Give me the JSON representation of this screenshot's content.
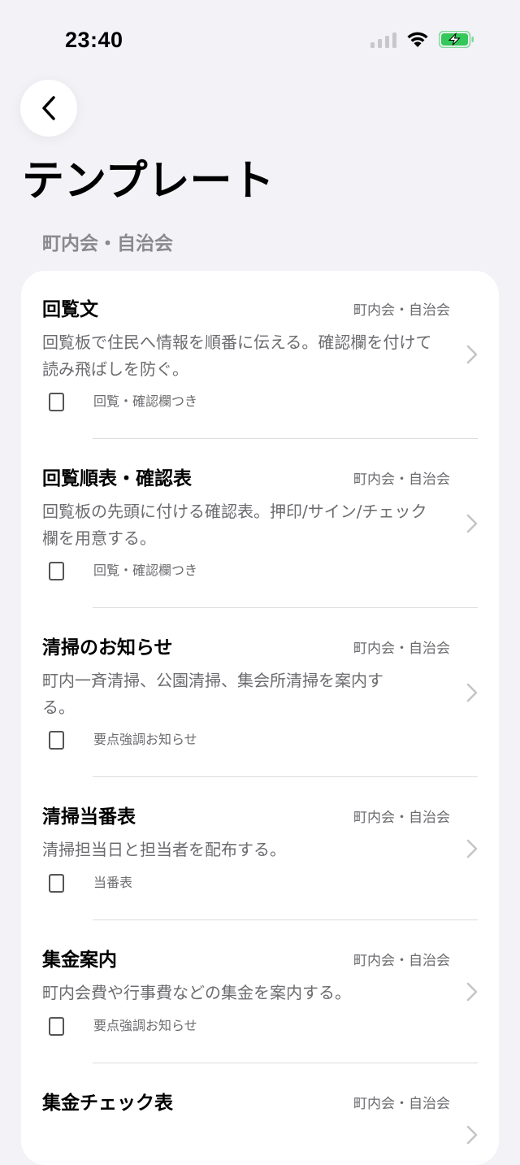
{
  "status_bar": {
    "time": "23:40"
  },
  "page": {
    "title": "テンプレート",
    "section": "町内会・自治会"
  },
  "items": [
    {
      "title": "回覧文",
      "category": "町内会・自治会",
      "description": "回覧板で住民へ情報を順番に伝える。確認欄を付けて読み飛ばしを防ぐ。",
      "tag": "回覧・確認欄つき"
    },
    {
      "title": "回覧順表・確認表",
      "category": "町内会・自治会",
      "description": "回覧板の先頭に付ける確認表。押印/サイン/チェック欄を用意する。",
      "tag": "回覧・確認欄つき"
    },
    {
      "title": "清掃のお知らせ",
      "category": "町内会・自治会",
      "description": "町内一斉清掃、公園清掃、集会所清掃を案内する。",
      "tag": "要点強調お知らせ"
    },
    {
      "title": "清掃当番表",
      "category": "町内会・自治会",
      "description": "清掃担当日と担当者を配布する。",
      "tag": "当番表"
    },
    {
      "title": "集金案内",
      "category": "町内会・自治会",
      "description": "町内会費や行事費などの集金を案内する。",
      "tag": "要点強調お知らせ"
    },
    {
      "title": "集金チェック表",
      "category": "町内会・自治会",
      "description": "",
      "tag": ""
    }
  ],
  "icons": {
    "back": "chevron-left-icon",
    "row": "chevron-right-icon",
    "signal": "cellular-signal-icon",
    "wifi": "wifi-icon",
    "battery": "battery-charging-icon"
  },
  "colors": {
    "background": "#f2f2f7",
    "card": "#ffffff",
    "secondary_text": "#6c6c70",
    "battery": "#34c759"
  }
}
